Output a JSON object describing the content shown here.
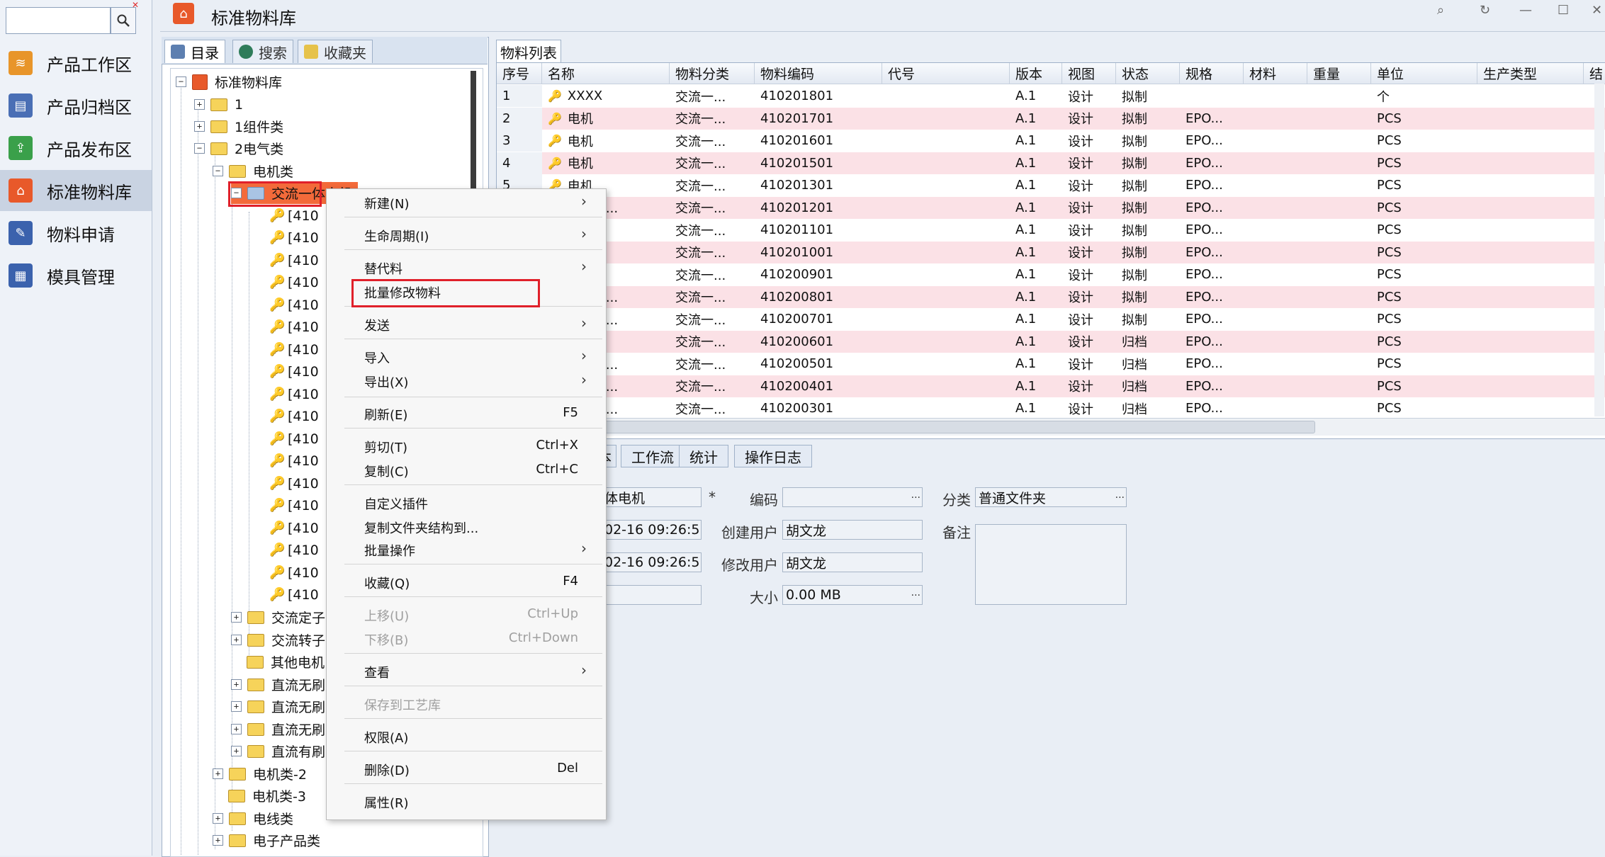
{
  "app": {
    "title": "标准物料库"
  },
  "nav": {
    "search_placeholder": "",
    "items": [
      {
        "label": "产品工作区",
        "color": "#e8952a"
      },
      {
        "label": "产品归档区",
        "color": "#4a6fb5"
      },
      {
        "label": "产品发布区",
        "color": "#3aa04a"
      },
      {
        "label": "标准物料库",
        "color": "#e8592a"
      },
      {
        "label": "物料申请",
        "color": "#3b62ad"
      },
      {
        "label": "模具管理",
        "color": "#3b62ad"
      }
    ]
  },
  "left_tabs": [
    "目录",
    "搜索",
    "收藏夹"
  ],
  "tree": {
    "root": "标准物料库",
    "n1": "1",
    "n2": "1组件类",
    "n3": "2电气类",
    "n4": "电机类",
    "n5": "交流一体电机",
    "item_text": "[410",
    "sub": [
      "交流定子",
      "交流转子",
      "其他电机",
      "直流无刷",
      "直流无刷",
      "直流无刷",
      "直流有刷"
    ],
    "after": [
      "电机类-2",
      "电机类-3",
      "电线类",
      "电子产品类"
    ]
  },
  "grid": {
    "tab": "物料列表",
    "columns": [
      "序号",
      "名称",
      "物料分类",
      "物料编码",
      "代号",
      "版本",
      "视图",
      "状态",
      "规格",
      "材料",
      "重量",
      "单位",
      "生产类型",
      "结"
    ],
    "rows": [
      {
        "no": "1",
        "name": "XXXX",
        "cat": "交流一...",
        "code": "410201801",
        "ver": "A.1",
        "view": "设计",
        "status": "拟制",
        "spec": "",
        "unit": "个"
      },
      {
        "no": "2",
        "name": "电机",
        "cat": "交流一...",
        "code": "410201701",
        "ver": "A.1",
        "view": "设计",
        "status": "拟制",
        "spec": "EPO...",
        "unit": "PCS"
      },
      {
        "no": "3",
        "name": "电机",
        "cat": "交流一...",
        "code": "410201601",
        "ver": "A.1",
        "view": "设计",
        "status": "拟制",
        "spec": "EPO...",
        "unit": "PCS"
      },
      {
        "no": "4",
        "name": "电机",
        "cat": "交流一...",
        "code": "410201501",
        "ver": "A.1",
        "view": "设计",
        "status": "拟制",
        "spec": "EPO...",
        "unit": "PCS"
      },
      {
        "no": "5",
        "name": "电机",
        "cat": "交流一...",
        "code": "410201301",
        "ver": "A.1",
        "view": "设计",
        "status": "拟制",
        "spec": "EPO...",
        "unit": "PCS"
      },
      {
        "no": "",
        "name": "（带挡...",
        "cat": "交流一...",
        "code": "410201201",
        "ver": "A.1",
        "view": "设计",
        "status": "拟制",
        "spec": "EPO...",
        "unit": "PCS"
      },
      {
        "no": "",
        "name": "",
        "cat": "交流一...",
        "code": "410201101",
        "ver": "A.1",
        "view": "设计",
        "status": "拟制",
        "spec": "EPO...",
        "unit": "PCS"
      },
      {
        "no": "",
        "name": "",
        "cat": "交流一...",
        "code": "410201001",
        "ver": "A.1",
        "view": "设计",
        "status": "拟制",
        "spec": "EPO...",
        "unit": "PCS"
      },
      {
        "no": "",
        "name": "",
        "cat": "交流一...",
        "code": "410200901",
        "ver": "A.1",
        "view": "设计",
        "status": "拟制",
        "spec": "EPO...",
        "unit": "PCS"
      },
      {
        "no": "",
        "name": "（带挡...",
        "cat": "交流一...",
        "code": "410200801",
        "ver": "A.1",
        "view": "设计",
        "status": "拟制",
        "spec": "EPO...",
        "unit": "PCS"
      },
      {
        "no": "",
        "name": "（带挡...",
        "cat": "交流一...",
        "code": "410200701",
        "ver": "A.1",
        "view": "设计",
        "status": "拟制",
        "spec": "EPO...",
        "unit": "PCS"
      },
      {
        "no": "",
        "name": "",
        "cat": "交流一...",
        "code": "410200601",
        "ver": "A.1",
        "view": "设计",
        "status": "归档",
        "spec": "EPO...",
        "unit": "PCS"
      },
      {
        "no": "",
        "name": "（带挡...",
        "cat": "交流一...",
        "code": "410200501",
        "ver": "A.1",
        "view": "设计",
        "status": "归档",
        "spec": "EPO...",
        "unit": "PCS"
      },
      {
        "no": "",
        "name": "（带挡...",
        "cat": "交流一...",
        "code": "410200401",
        "ver": "A.1",
        "view": "设计",
        "status": "归档",
        "spec": "EPO...",
        "unit": "PCS"
      },
      {
        "no": "",
        "name": "（不带...",
        "cat": "交流一...",
        "code": "410200301",
        "ver": "A.1",
        "view": "设计",
        "status": "归档",
        "spec": "EPO...",
        "unit": "PCS"
      }
    ]
  },
  "bottom_tabs": [
    "本",
    "工作流",
    "统计",
    "操作日志"
  ],
  "form": {
    "name_value": "体电机",
    "required_mark": "*",
    "code_label": "编码",
    "code_value": "",
    "cat_label": "分类",
    "cat_value": "普通文件夹",
    "create_time": "02-16 09:26:5",
    "create_user_label": "创建用户",
    "create_user": "胡文龙",
    "remark_label": "备注",
    "modify_time": "02-16 09:26:5",
    "modify_user_label": "修改用户",
    "modify_user": "胡文龙",
    "size_label": "大小",
    "size_value": "0.00 MB",
    "dots": "..."
  },
  "menu": {
    "items": [
      {
        "label": "新建(N)",
        "sub": true
      },
      {
        "label": "生命周期(I)",
        "sub": true
      },
      {
        "label": "替代料",
        "sub": true
      },
      {
        "label": "批量修改物料"
      },
      {
        "label": "发送",
        "sub": true
      },
      {
        "label": "导入",
        "sub": true
      },
      {
        "label": "导出(X)",
        "sub": true
      },
      {
        "label": "刷新(E)",
        "shortcut": "F5"
      },
      {
        "label": "剪切(T)",
        "shortcut": "Ctrl+X"
      },
      {
        "label": "复制(C)",
        "shortcut": "Ctrl+C"
      },
      {
        "label": "自定义插件"
      },
      {
        "label": "复制文件夹结构到..."
      },
      {
        "label": "批量操作",
        "sub": true
      },
      {
        "label": "收藏(Q)",
        "shortcut": "F4"
      },
      {
        "label": "上移(U)",
        "shortcut": "Ctrl+Up",
        "disabled": true
      },
      {
        "label": "下移(B)",
        "shortcut": "Ctrl+Down",
        "disabled": true
      },
      {
        "label": "查看",
        "sub": true
      },
      {
        "label": "保存到工艺库",
        "disabled": true
      },
      {
        "label": "权限(A)"
      },
      {
        "label": "删除(D)",
        "shortcut": "Del"
      },
      {
        "label": "属性(R)"
      }
    ]
  }
}
